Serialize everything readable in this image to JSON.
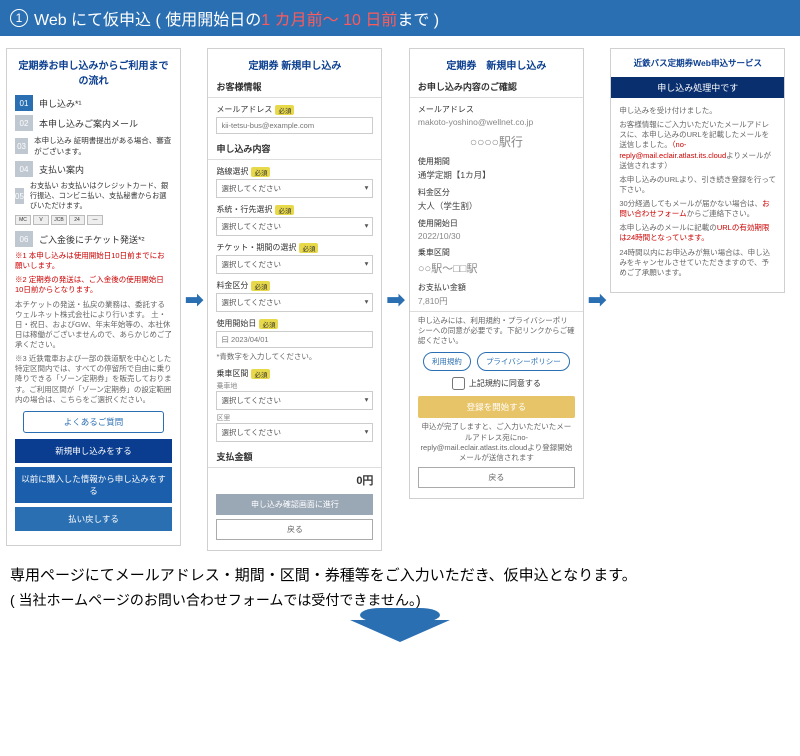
{
  "header": {
    "num": "1",
    "pre": "Web にて仮申込 ( 使用開始日の ",
    "red": "1 カ月前～ 10 日前",
    "post": "まで )"
  },
  "panel1": {
    "title": "定期券お申し込みからご利用までの流れ",
    "steps": [
      "申し込み*¹",
      "本申し込みご案内メール",
      "本申し込み  証明書提出がある場合、審査がございます。",
      "支払い案内",
      "お支払い  お支払いはクレジットカード、銀行振込、コンビニ払い、支払秘書からお選びいただけます。",
      "ご入金後にチケット発送*²"
    ],
    "notes1": "※1 本申し込みは使用開始日10日前までにお願いします。",
    "notes2": "※2 定期券の発送は、ご入金後の使用開始日10日前からとなります。",
    "notes3": "本チケットの発送・払戻の業務は、委託するウェルネット株式会社により行います。\n土・日・祝日、およびGW、年末年始等の、本社休日は稼働がございませんので、あらかじめご了承ください。",
    "notes4": "※3 近鉄電車および一部の鉄道駅を中心とした特定区間内では、すべての停留所で自由に乗り降りできる「ゾーン定期券」を販売しております。ご利用区間が「ゾーン定期券」の設定範囲内の場合は、こちらをご選択ください。",
    "faq": "よくあるご質問",
    "btn_new": "新規申し込みをする",
    "btn_prev": "以前に購入した情報から申し込みをする",
    "btn_refund": "払い戻しする"
  },
  "panel2": {
    "title": "定期券 新規申し込み",
    "h_cust": "お客様情報",
    "l_email": "メールアドレス",
    "ph_email": "kii-tetsu-bus@example.com",
    "h_content": "申し込み内容",
    "l_route": "路線選択",
    "l_line": "系統・行先選択",
    "l_ticket": "チケット・期間の選択",
    "l_fare": "料金区分",
    "l_start": "使用開始日",
    "ph_start": "曰 2023/04/01",
    "startnote": "*青数字を入力してください。",
    "l_board": "乗車区間",
    "sub_board": "乗車地",
    "l_drop": "区里",
    "opt_sel": "選択してください",
    "h_amount": "支払金額",
    "amount": "0円",
    "btn_confirm": "申し込み確認画面に進行",
    "btn_back": "戻る"
  },
  "panel3": {
    "title": "定期券　新規申し込み",
    "h_confirm": "お申し込み内容のご確認",
    "l_email": "メールアドレス",
    "v_email": "makoto-yoshino@wellnet.co.jp",
    "dest": "○○○○駅行",
    "l_period": "使用期間",
    "v_period": "通学定期【1カ月】",
    "l_fare": "料金区分",
    "v_fare": "大人（学生割）",
    "l_start": "使用開始日",
    "v_start": "2022/10/30",
    "l_section": "乗車区間",
    "v_section": "○○駅～□□駅",
    "l_pay": "お支払い金額",
    "v_pay": "7,810円",
    "agree_note": "申し込みには、利用規約・プライバシーポリシーへの同意が必要です。下記リンクからご確認ください。",
    "pill_terms": "利用規約",
    "pill_priv": "プライバシーポリシー",
    "chk": "上記規約に同意する",
    "btn_reg": "登録を開始する",
    "done_note": "申込が完了しますと、ご入力いただいたメールアドレス宛にno-reply@mail.eclair.atlast.its.cloudより登録開始メールが送信されます",
    "btn_back": "戻る"
  },
  "panel4": {
    "svc": "近鉄バス定期券Web申込サービス",
    "band": "申し込み処理中です",
    "l1": "申し込みを受け付けました。",
    "l2": "お客様情報にご入力いただいたメールアドレスに、本申し込みのURLを記載したメールを送信しました。",
    "l2r": "（no-reply@mail.eclair.atlast.its.cloud",
    "l2b": "よりメールが送信されます）",
    "l3": "本申し込みのURLより、引き続き登録を行って下さい。",
    "l4a": "30分経過してもメールが届かない場合は、",
    "l4r": "お問い合わせフォーム",
    "l4b": "からご連絡下さい。",
    "l5a": "本申し込みのメールに記載の",
    "l5r": "URLの有効期限は24時間となっています。",
    "l6": "24時間以内にお申込みが無い場合は、申し込みをキャンセルさせていただきますので、予めご了承願います。"
  },
  "footer": {
    "main": "専用ページにてメールアドレス・期間・区間・券種等をご入力いただき、仮申込となります。",
    "sub": "( 当社ホームページのお問い合わせフォームでは受付できません。)"
  }
}
